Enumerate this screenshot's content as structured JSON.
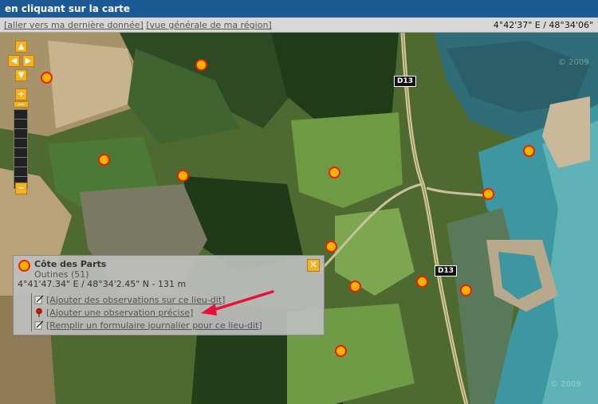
{
  "header": {
    "title": "en cliquant sur la carte"
  },
  "toolbar": {
    "link_last": "[aller vers ma dernière donnée]",
    "link_region": "[vue générale de ma région]",
    "coords": "4°42'37\" E / 48°34'06\""
  },
  "map": {
    "road_labels": [
      "D13",
      "D13"
    ],
    "watermark": "© 2009"
  },
  "popup": {
    "title": "Côte des Parts",
    "subtitle": "Outines (51)",
    "coords": "4°41'47.34\" E / 48°34'2.45\" N - 131 m",
    "actions": [
      {
        "label": "[Ajouter des observations sur ce lieu-dit]",
        "icon": "pencil-note-icon"
      },
      {
        "label": "[Ajouter une observation précise]",
        "icon": "red-pin-icon"
      },
      {
        "label": "[Remplir un formulaire journalier pour ce lieu-dit]",
        "icon": "pencil-note-icon"
      }
    ],
    "close_label": "✕"
  },
  "colors": {
    "accent": "#f3b221",
    "marker_border": "#e8200a",
    "titlebar": "#1c5a96"
  }
}
